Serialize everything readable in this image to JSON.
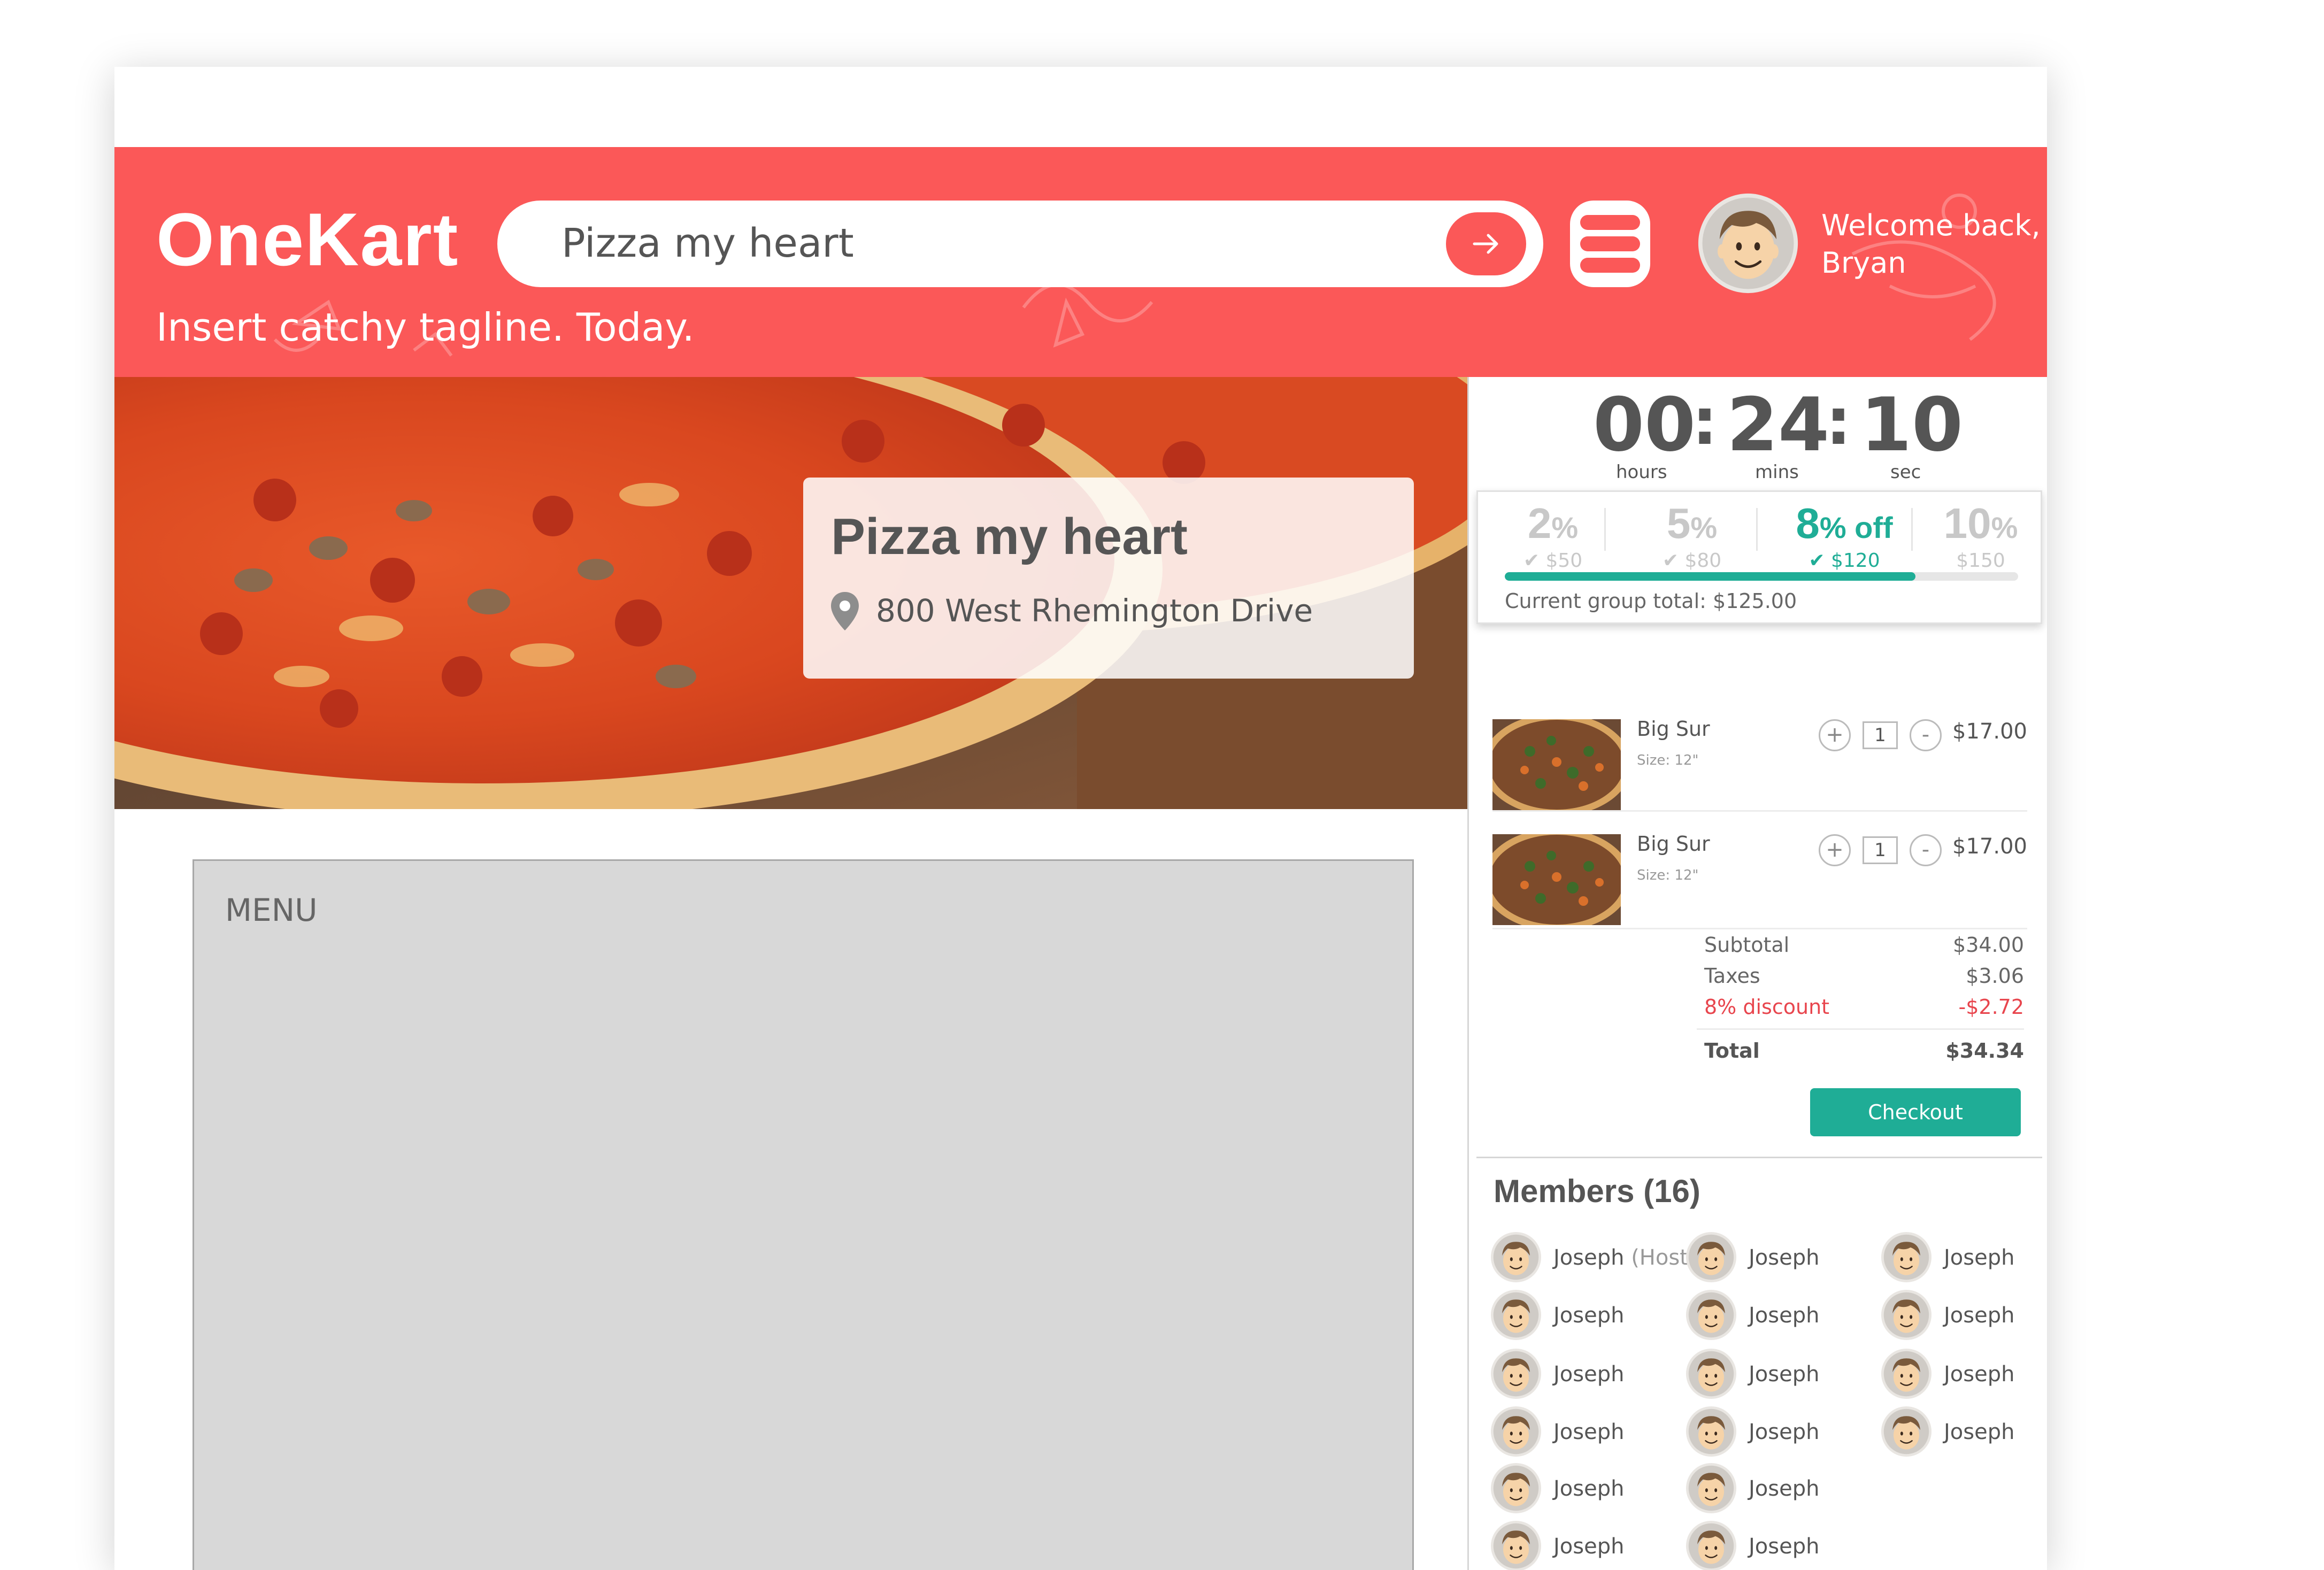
{
  "app": {
    "logo": "OneKart",
    "tagline": "Insert catchy tagline. Today.",
    "welcome_line1": "Welcome back,",
    "welcome_line2": "Bryan"
  },
  "search": {
    "value": "Pizza my heart",
    "submit_icon": "arrow-right-icon"
  },
  "menu_button_icon": "hamburger-menu-icon",
  "restaurant": {
    "name": "Pizza my heart",
    "address": "800 West Rhemington Drive"
  },
  "menu": {
    "label": "MENU"
  },
  "timer": {
    "hours": "00",
    "minutes": "24",
    "seconds": "10",
    "hours_label": "hours",
    "minutes_label": "mins",
    "seconds_label": "sec"
  },
  "discounts": {
    "tiers": [
      {
        "pct": "2",
        "unit": "%",
        "amount": "$50",
        "reached": true,
        "active": false
      },
      {
        "pct": "5",
        "unit": "%",
        "amount": "$80",
        "reached": true,
        "active": false
      },
      {
        "pct": "8",
        "unit": "% off",
        "amount": "$120",
        "reached": true,
        "active": true
      },
      {
        "pct": "10",
        "unit": "%",
        "amount": "$150",
        "reached": false,
        "active": false
      }
    ],
    "progress_fraction": 0.8,
    "group_total_text": "Current group total: $125.00",
    "accent_color": "#1fad96"
  },
  "cart": {
    "items": [
      {
        "name": "Big Sur",
        "size": "Size: 12\"",
        "qty": "1",
        "price": "$17.00",
        "plus": "+",
        "minus": "-"
      },
      {
        "name": "Big Sur",
        "size": "Size: 12\"",
        "qty": "1",
        "price": "$17.00",
        "plus": "+",
        "minus": "-"
      }
    ],
    "summary": {
      "subtotal_label": "Subtotal",
      "subtotal": "$34.00",
      "taxes_label": "Taxes",
      "taxes": "$3.06",
      "discount_label": "8% discount",
      "discount": "-$2.72",
      "total_label": "Total",
      "total": "$34.34"
    },
    "checkout_label": "Checkout"
  },
  "members": {
    "title": "Members (16)",
    "list": [
      {
        "name": "Joseph",
        "host": "(Host)"
      },
      {
        "name": "Joseph"
      },
      {
        "name": "Joseph"
      },
      {
        "name": "Joseph"
      },
      {
        "name": "Joseph"
      },
      {
        "name": "Joseph"
      },
      {
        "name": "Joseph"
      },
      {
        "name": "Joseph"
      },
      {
        "name": "Joseph"
      },
      {
        "name": "Joseph"
      },
      {
        "name": "Joseph"
      },
      {
        "name": "Joseph"
      },
      {
        "name": "Joseph"
      },
      {
        "name": "Joseph"
      },
      {
        "name": "Joseph"
      },
      {
        "name": "Joseph"
      }
    ]
  },
  "colors": {
    "brand": "#fb5858",
    "accent": "#1fad96",
    "discount": "#e8454d"
  }
}
